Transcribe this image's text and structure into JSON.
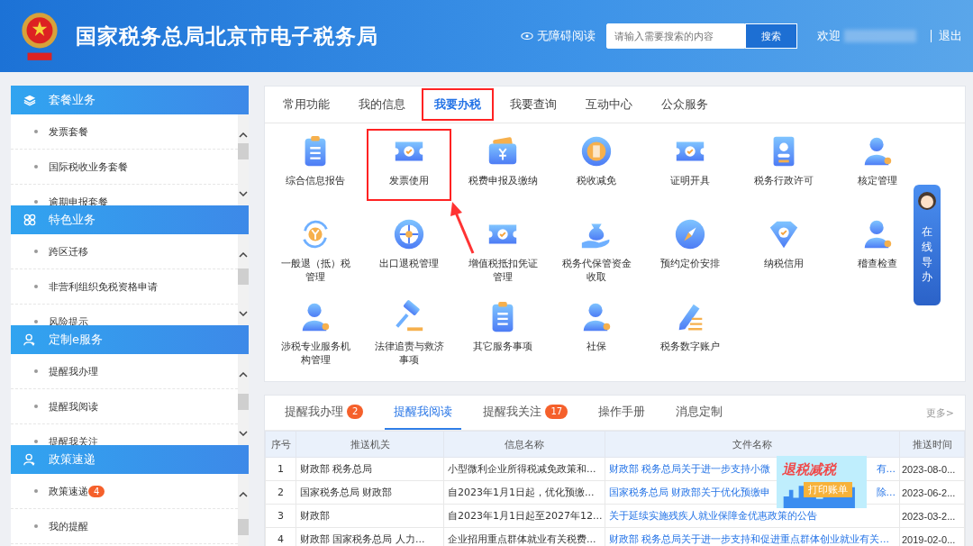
{
  "header": {
    "title": "国家税务总局北京市电子税务局",
    "accessibility": "无障碍阅读",
    "search": {
      "placeholder": "请输入需要搜索的内容",
      "button": "搜索"
    },
    "welcome": "欢迎",
    "logout": "退出"
  },
  "sidebar": [
    {
      "title": "套餐业务",
      "items": [
        {
          "label": "发票套餐"
        },
        {
          "label": "国际税收业务套餐"
        },
        {
          "label": "逾期申报套餐"
        }
      ]
    },
    {
      "title": "特色业务",
      "items": [
        {
          "label": "跨区迁移"
        },
        {
          "label": "非营利组织免税资格申请"
        },
        {
          "label": "风险提示"
        }
      ]
    },
    {
      "title": "定制e服务",
      "items": [
        {
          "label": "提醒我办理"
        },
        {
          "label": "提醒我阅读"
        },
        {
          "label": "提醒我关注"
        }
      ]
    },
    {
      "title": "政策速递",
      "items": [
        {
          "label": "政策速递",
          "badge": "4"
        },
        {
          "label": "我的提醒"
        }
      ]
    }
  ],
  "main_tabs": [
    {
      "label": "常用功能",
      "selected": false,
      "highlighted": false
    },
    {
      "label": "我的信息",
      "selected": false,
      "highlighted": false
    },
    {
      "label": "我要办税",
      "selected": true,
      "highlighted": true
    },
    {
      "label": "我要查询",
      "selected": false,
      "highlighted": false
    },
    {
      "label": "互动中心",
      "selected": false,
      "highlighted": false
    },
    {
      "label": "公众服务",
      "selected": false,
      "highlighted": false
    }
  ],
  "services": [
    {
      "label": "综合信息报告",
      "highlighted": false
    },
    {
      "label": "发票使用",
      "highlighted": true
    },
    {
      "label": "税费申报及缴纳",
      "highlighted": false
    },
    {
      "label": "税收减免",
      "highlighted": false
    },
    {
      "label": "证明开具",
      "highlighted": false
    },
    {
      "label": "税务行政许可",
      "highlighted": false
    },
    {
      "label": "核定管理",
      "highlighted": false
    },
    {
      "label": "一般退（抵）税管理",
      "highlighted": false
    },
    {
      "label": "出口退税管理",
      "highlighted": false
    },
    {
      "label": "增值税抵扣凭证管理",
      "highlighted": false
    },
    {
      "label": "税务代保管资金收取",
      "highlighted": false
    },
    {
      "label": "预约定价安排",
      "highlighted": false
    },
    {
      "label": "纳税信用",
      "highlighted": false
    },
    {
      "label": "稽查检查",
      "highlighted": false
    },
    {
      "label": "涉税专业服务机构管理",
      "highlighted": false
    },
    {
      "label": "法律追责与救济事项",
      "highlighted": false
    },
    {
      "label": "其它服务事项",
      "highlighted": false
    },
    {
      "label": "社保",
      "highlighted": false
    },
    {
      "label": "税务数字账户",
      "highlighted": false
    }
  ],
  "online_guide": "在线导办",
  "notice_tabs": [
    {
      "label": "提醒我办理",
      "badge": "2",
      "selected": false
    },
    {
      "label": "提醒我阅读",
      "selected": true
    },
    {
      "label": "提醒我关注",
      "badge": "17",
      "selected": false
    },
    {
      "label": "操作手册",
      "selected": false
    },
    {
      "label": "消息定制",
      "selected": false
    }
  ],
  "more": "更多>",
  "table": {
    "columns": [
      "序号",
      "推送机关",
      "信息名称",
      "文件名称",
      "推送时间"
    ],
    "rows": [
      {
        "no": "1",
        "agency": "财政部 税务总局",
        "info": "小型微利企业所得税减免政策和...",
        "file": "财政部 税务总局关于进一步支持小微",
        "file_tail": "有...",
        "time": "2023-08-0..."
      },
      {
        "no": "2",
        "agency": "国家税务总局 财政部",
        "info": "自2023年1月1日起，优化预缴...",
        "file": "国家税务总局 财政部关于优化预缴申",
        "file_tail": "除...",
        "time": "2023-06-2..."
      },
      {
        "no": "3",
        "agency": "财政部",
        "info": "自2023年1月1日起至2027年12...",
        "file": "关于延续实施残疾人就业保障金优惠政策的公告",
        "time": "2023-03-2..."
      },
      {
        "no": "4",
        "agency": "财政部 国家税务总局 人力...",
        "info": "企业招用重点群体就业有关税费...",
        "file": "财政部 税务总局关于进一步支持和促进重点群体创业就业有关...",
        "time": "2019-02-0..."
      }
    ]
  },
  "promo": {
    "title": "退税减税",
    "subtitle": "打印账单"
  }
}
